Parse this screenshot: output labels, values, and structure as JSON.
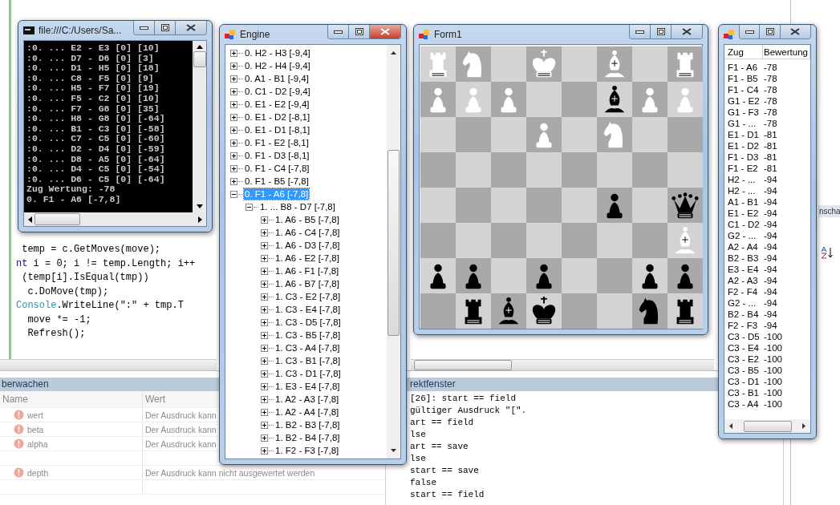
{
  "ide": {
    "code_lines": [
      {
        "segments": [
          {
            "kind": "plain",
            "text": " temp = c.GetMoves(move);"
          }
        ]
      },
      {
        "segments": [
          {
            "kind": "keyword",
            "text": "nt"
          },
          {
            "kind": "plain",
            "text": " i = 0; i != temp.Length; i++"
          }
        ]
      },
      {
        "segments": [
          {
            "kind": "plain",
            "text": " (temp[i].IsEqual(tmp))"
          }
        ]
      },
      {
        "segments": [
          {
            "kind": "plain",
            "text": "  c.DoMove(tmp);"
          }
        ]
      },
      {
        "segments": [
          {
            "kind": "type",
            "text": "Console"
          },
          {
            "kind": "plain",
            "text": ".WriteLine(\":\" + tmp.T"
          }
        ]
      },
      {
        "segments": [
          {
            "kind": "plain",
            "text": "  move *= -1;"
          }
        ]
      },
      {
        "segments": [
          {
            "kind": "plain",
            "text": "  Refresh();"
          }
        ]
      }
    ],
    "watch": {
      "title": "berwachen",
      "columns": [
        "Name",
        "Wert"
      ],
      "rows": [
        {
          "kind": "error",
          "name": "wert",
          "value": "Der Ausdruck kann"
        },
        {
          "kind": "error",
          "name": "beta",
          "value": "Der Ausdruck kann"
        },
        {
          "kind": "error",
          "name": "alpha",
          "value": "Der Ausdruck kann"
        },
        {
          "kind": "blank"
        },
        {
          "kind": "error",
          "name": "depth",
          "value": "Der Ausdruck kann nicht ausgewertet werden"
        },
        {
          "kind": "blank"
        }
      ]
    },
    "immediate": {
      "title": "rektfenster",
      "lines": [
        "[26]: start == field",
        "gültiger Ausdruck \"[\".",
        "art == field",
        "lse",
        "art == save",
        "lse",
        "start == save",
        "false",
        "start == field"
      ]
    },
    "side_tab": "nscha"
  },
  "console_window": {
    "title": "file:///C:/Users/Sa...",
    "lines": [
      ":0. ... E2 - E3 [0] [10]",
      ":0. ... D7 - D6 [0] [3]",
      ":0. ... D1 - H5 [0] [18]",
      ":0. ... C8 - F5 [0] [9]",
      ":0. ... H5 - F7 [0] [19]",
      ":0. ... F5 - C2 [0] [10]",
      ":0. ... F7 - G8 [0] [35]",
      ":0. ... H8 - G8 [0] [-64]",
      ":0. ... B1 - C3 [0] [-58]",
      ":0. ... C7 - C5 [0] [-60]",
      ":0. ... D2 - D4 [0] [-59]",
      ":0. ... D8 - A5 [0] [-64]",
      ":0. ... D4 - C5 [0] [-54]",
      ":0. ... D6 - C5 [0] [-64]",
      "Zug Wertung: -78",
      "0. F1 - A6 [-7,8]"
    ]
  },
  "engine_window": {
    "title": "Engine",
    "tree": [
      {
        "label": "0. H2 - H3 [-9,4]",
        "expanded": false,
        "selected": false
      },
      {
        "label": "0. H2 - H4 [-9,4]",
        "expanded": false,
        "selected": false
      },
      {
        "label": "0. A1 - B1 [-9,4]",
        "expanded": false,
        "selected": false
      },
      {
        "label": "0. C1 - D2 [-9,4]",
        "expanded": false,
        "selected": false
      },
      {
        "label": "0. E1 - E2 [-9,4]",
        "expanded": false,
        "selected": false
      },
      {
        "label": "0. E1 - D2 [-8,1]",
        "expanded": false,
        "selected": false
      },
      {
        "label": "0. E1 - D1 [-8,1]",
        "expanded": false,
        "selected": false
      },
      {
        "label": "0. F1 - E2 [-8,1]",
        "expanded": false,
        "selected": false
      },
      {
        "label": "0. F1 - D3 [-8,1]",
        "expanded": false,
        "selected": false
      },
      {
        "label": "0. F1 - C4 [-7,8]",
        "expanded": false,
        "selected": false
      },
      {
        "label": "0. F1 - B5 [-7,8]",
        "expanded": false,
        "selected": false
      },
      {
        "label": "0. F1 - A6 [-7,8]",
        "expanded": true,
        "selected": true,
        "children": [
          {
            "label": "1. ... B8 - D7 [-7,8]",
            "expanded": true,
            "selected": false,
            "children": [
              {
                "label": "1. A6 - B5 [-7,8]",
                "expanded": false,
                "selected": false
              },
              {
                "label": "1. A6 - C4 [-7,8]",
                "expanded": false,
                "selected": false
              },
              {
                "label": "1. A6 - D3 [-7,8]",
                "expanded": false,
                "selected": false
              },
              {
                "label": "1. A6 - E2 [-7,8]",
                "expanded": false,
                "selected": false
              },
              {
                "label": "1. A6 - F1 [-7,8]",
                "expanded": false,
                "selected": false
              },
              {
                "label": "1. A6 - B7 [-7,8]",
                "expanded": false,
                "selected": false
              },
              {
                "label": "1. C3 - E2 [-7,8]",
                "expanded": false,
                "selected": false
              },
              {
                "label": "1. C3 - E4 [-7,8]",
                "expanded": false,
                "selected": false
              },
              {
                "label": "1. C3 - D5 [-7,8]",
                "expanded": false,
                "selected": false
              },
              {
                "label": "1. C3 - B5 [-7,8]",
                "expanded": false,
                "selected": false
              },
              {
                "label": "1. C3 - A4 [-7,8]",
                "expanded": false,
                "selected": false
              },
              {
                "label": "1. C3 - B1 [-7,8]",
                "expanded": false,
                "selected": false
              },
              {
                "label": "1. C3 - D1 [-7,8]",
                "expanded": false,
                "selected": false
              },
              {
                "label": "1. E3 - E4 [-7,8]",
                "expanded": false,
                "selected": false
              },
              {
                "label": "1. A2 - A3 [-7,8]",
                "expanded": false,
                "selected": false
              },
              {
                "label": "1. A2 - A4 [-7,8]",
                "expanded": false,
                "selected": false
              },
              {
                "label": "1. B2 - B3 [-7,8]",
                "expanded": false,
                "selected": false
              },
              {
                "label": "1. B2 - B4 [-7,8]",
                "expanded": false,
                "selected": false
              },
              {
                "label": "1. F2 - F3 [-7,8]",
                "expanded": false,
                "selected": false
              }
            ]
          }
        ]
      }
    ]
  },
  "board_window": {
    "title": "Form1",
    "board": [
      [
        {
          "kind": "rook",
          "color": "#ffffff"
        },
        {
          "kind": "knight",
          "color": "#ffffff"
        },
        {
          "kind": "empty"
        },
        {
          "kind": "king",
          "color": "#ffffff"
        },
        {
          "kind": "empty"
        },
        {
          "kind": "bishop",
          "color": "#ffffff"
        },
        {
          "kind": "empty"
        },
        {
          "kind": "rook",
          "color": "#ffffff"
        }
      ],
      [
        {
          "kind": "pawn",
          "color": "#ffffff"
        },
        {
          "kind": "pawn",
          "color": "#ffffff"
        },
        {
          "kind": "pawn",
          "color": "#ffffff"
        },
        {
          "kind": "empty"
        },
        {
          "kind": "empty"
        },
        {
          "kind": "bishop",
          "color": "#000000"
        },
        {
          "kind": "pawn",
          "color": "#ffffff"
        },
        {
          "kind": "pawn",
          "color": "#ffffff"
        }
      ],
      [
        {
          "kind": "empty"
        },
        {
          "kind": "empty"
        },
        {
          "kind": "empty"
        },
        {
          "kind": "pawn",
          "color": "#ffffff"
        },
        {
          "kind": "empty"
        },
        {
          "kind": "knight",
          "color": "#ffffff"
        },
        {
          "kind": "empty"
        },
        {
          "kind": "empty"
        }
      ],
      [
        {
          "kind": "empty"
        },
        {
          "kind": "empty"
        },
        {
          "kind": "empty"
        },
        {
          "kind": "empty"
        },
        {
          "kind": "empty"
        },
        {
          "kind": "empty"
        },
        {
          "kind": "empty"
        },
        {
          "kind": "empty"
        }
      ],
      [
        {
          "kind": "empty"
        },
        {
          "kind": "empty"
        },
        {
          "kind": "empty"
        },
        {
          "kind": "empty"
        },
        {
          "kind": "empty"
        },
        {
          "kind": "pawn",
          "color": "#000000"
        },
        {
          "kind": "empty"
        },
        {
          "kind": "queen",
          "color": "#000000"
        }
      ],
      [
        {
          "kind": "empty"
        },
        {
          "kind": "empty"
        },
        {
          "kind": "empty"
        },
        {
          "kind": "empty"
        },
        {
          "kind": "empty"
        },
        {
          "kind": "empty"
        },
        {
          "kind": "empty"
        },
        {
          "kind": "bishop",
          "color": "#ffffff"
        }
      ],
      [
        {
          "kind": "pawn",
          "color": "#000000"
        },
        {
          "kind": "pawn",
          "color": "#000000"
        },
        {
          "kind": "empty"
        },
        {
          "kind": "pawn",
          "color": "#000000"
        },
        {
          "kind": "empty"
        },
        {
          "kind": "empty"
        },
        {
          "kind": "pawn",
          "color": "#000000"
        },
        {
          "kind": "pawn",
          "color": "#000000"
        }
      ],
      [
        {
          "kind": "empty"
        },
        {
          "kind": "rook",
          "color": "#000000"
        },
        {
          "kind": "bishop",
          "color": "#000000"
        },
        {
          "kind": "king",
          "color": "#000000"
        },
        {
          "kind": "empty"
        },
        {
          "kind": "empty"
        },
        {
          "kind": "knight",
          "color": "#000000"
        },
        {
          "kind": "rook",
          "color": "#000000"
        }
      ]
    ]
  },
  "moves_window": {
    "columns": [
      "Zug",
      "Bewertung"
    ],
    "rows": [
      {
        "move": "F1 - A6",
        "score": "-78"
      },
      {
        "move": "F1 - B5",
        "score": "-78"
      },
      {
        "move": "F1 - C4",
        "score": "-78"
      },
      {
        "move": "G1 - E2",
        "score": "-78"
      },
      {
        "move": "G1 - F3",
        "score": "-78"
      },
      {
        "move": "G1 - ...",
        "score": "-78"
      },
      {
        "move": "E1 - D1",
        "score": "-81"
      },
      {
        "move": "E1 - D2",
        "score": "-81"
      },
      {
        "move": "F1 - D3",
        "score": "-81"
      },
      {
        "move": "F1 - E2",
        "score": "-81"
      },
      {
        "move": "H2 - ...",
        "score": "-94"
      },
      {
        "move": "H2 - ...",
        "score": "-94"
      },
      {
        "move": "A1 - B1",
        "score": "-94"
      },
      {
        "move": "E1 - E2",
        "score": "-94"
      },
      {
        "move": "C1 - D2",
        "score": "-94"
      },
      {
        "move": "G2 - ...",
        "score": "-94"
      },
      {
        "move": "A2 - A4",
        "score": "-94"
      },
      {
        "move": "B2 - B3",
        "score": "-94"
      },
      {
        "move": "E3 - E4",
        "score": "-94"
      },
      {
        "move": "A2 - A3",
        "score": "-94"
      },
      {
        "move": "F2 - F4",
        "score": "-94"
      },
      {
        "move": "G2 - ...",
        "score": "-94"
      },
      {
        "move": "B2 - B4",
        "score": "-94"
      },
      {
        "move": "F2 - F3",
        "score": "-94"
      },
      {
        "move": "C3 - D5",
        "score": "-100"
      },
      {
        "move": "C3 - E4",
        "score": "-100"
      },
      {
        "move": "C3 - E2",
        "score": "-100"
      },
      {
        "move": "C3 - B5",
        "score": "-100"
      },
      {
        "move": "C3 - D1",
        "score": "-100"
      },
      {
        "move": "C3 - B1",
        "score": "-100"
      },
      {
        "move": "C3 - A4",
        "score": "-100"
      }
    ]
  }
}
